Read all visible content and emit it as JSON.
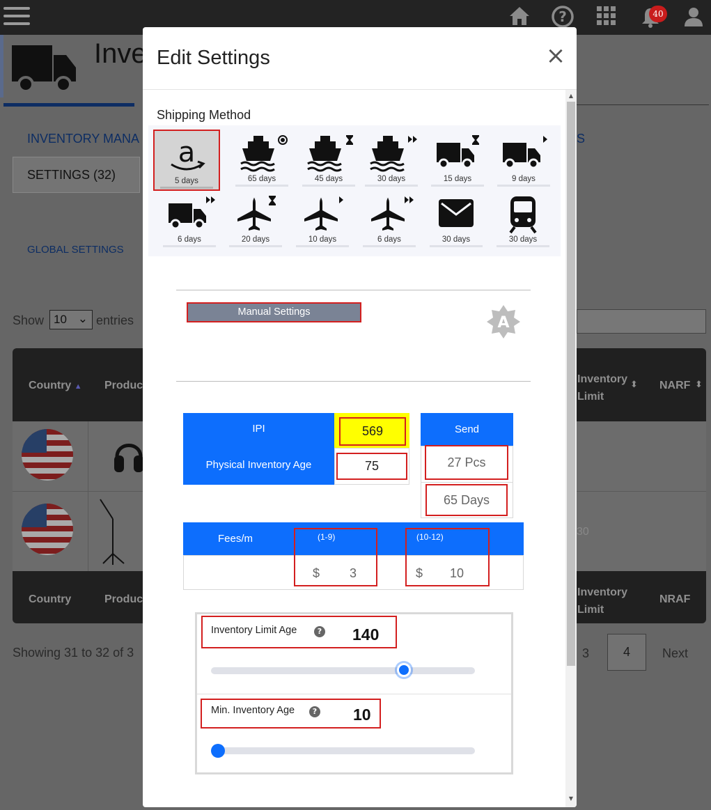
{
  "topbar": {
    "notification_count": "40"
  },
  "background": {
    "page_title": "Inve",
    "tab_nav_text": "INVENTORY MANA",
    "tab_nav_tail": "S",
    "settings_tab": "SETTINGS (32)",
    "global_settings": "GLOBAL SETTINGS",
    "show_label": "Show",
    "entries_value": "10",
    "entries_label": "entries",
    "table": {
      "col_country": "Country",
      "col_product": "Produc",
      "col_inventory_limit_1": "Inventory",
      "col_inventory_limit_2": "Limit",
      "col_narf": "NARF",
      "footer_country": "Country",
      "footer_product": "Produc",
      "footer_inventory_limit_1": "Inventory",
      "footer_inventory_limit_2": "Limit",
      "footer_nraf": "NRAF",
      "row2_partial": "30"
    },
    "showing_text": "Showing 31 to 32 of 3",
    "pagination": {
      "page_3": "3",
      "page_4": "4",
      "next": "Next"
    }
  },
  "modal": {
    "title": "Edit Settings",
    "close": "×",
    "shipping_method_label": "Shipping Method",
    "shipping_options": [
      {
        "icon": "amazon-icon",
        "label": "5 days",
        "selected": true
      },
      {
        "icon": "ship-target-icon",
        "label": "65 days"
      },
      {
        "icon": "ship-hourglass-icon",
        "label": "45 days"
      },
      {
        "icon": "ship-fast-forward-icon",
        "label": "30 days"
      },
      {
        "icon": "truck-hourglass-icon",
        "label": "15 days"
      },
      {
        "icon": "truck-play-icon",
        "label": "9 days"
      },
      {
        "icon": "truck-fast-forward-icon",
        "label": "6 days"
      },
      {
        "icon": "plane-hourglass-icon",
        "label": "20 days"
      },
      {
        "icon": "plane-play-icon",
        "label": "10 days"
      },
      {
        "icon": "plane-fast-forward-icon",
        "label": "6 days"
      },
      {
        "icon": "mail-icon",
        "label": "30 days"
      },
      {
        "icon": "train-icon",
        "label": "30 days"
      }
    ],
    "manual_settings_label": "Manual Settings",
    "auto_badge_letter": "A",
    "ipi_label": "IPI",
    "ipi_value": "569",
    "physical_inventory_age_label": "Physical Inventory Age",
    "physical_inventory_age_value": "75",
    "send_label": "Send",
    "send_pcs": "27 Pcs",
    "send_days": "65 Days",
    "fees_label": "Fees/m",
    "fees_range_1": "(1-9)",
    "fees_range_2": "(10-12)",
    "currency": "$",
    "fees_value_1": "3",
    "fees_value_2": "10",
    "inventory_limit_age_label": "Inventory Limit Age",
    "inventory_limit_age_value": "140",
    "inventory_limit_age_fraction": 0.75,
    "min_inventory_age_label": "Min. Inventory Age",
    "min_inventory_age_value": "10",
    "min_inventory_age_fraction": 0.0,
    "help_glyph": "?"
  },
  "colors": {
    "accent_blue": "#0d6efd",
    "highlight_red": "#d31f1f",
    "ipi_yellow": "#ffff00"
  }
}
